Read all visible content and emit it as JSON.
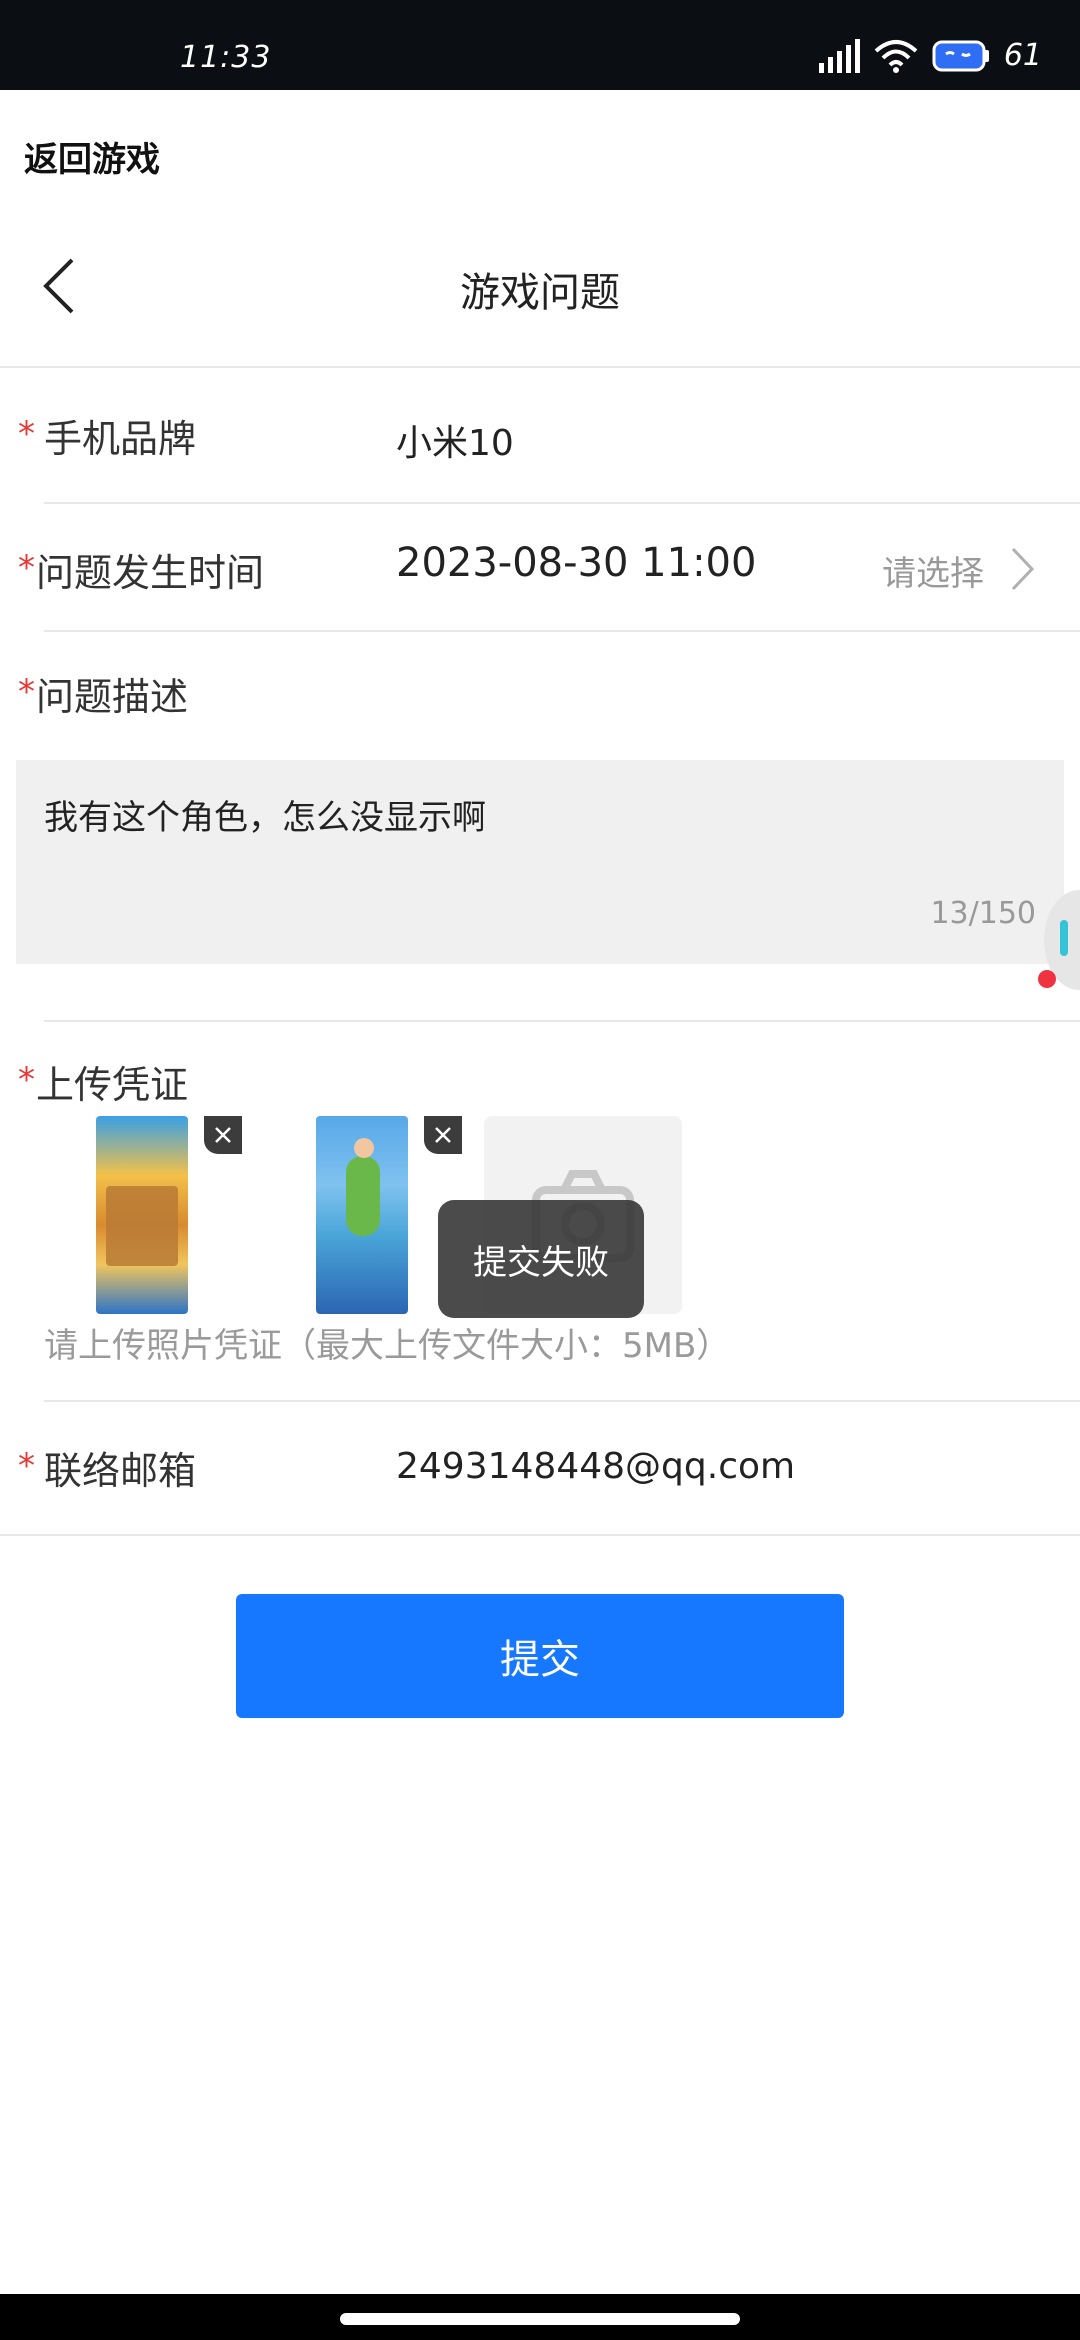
{
  "status_bar": {
    "time": "11:33",
    "battery": "61"
  },
  "return_game": "返回游戏",
  "header": {
    "title": "游戏问题"
  },
  "form": {
    "required_mark": "*",
    "phone_brand": {
      "label": "手机品牌",
      "value": "小米10"
    },
    "issue_time": {
      "label": "问题发生时间",
      "value": "2023-08-30 11:00",
      "hint": "请选择"
    },
    "description": {
      "label": "问题描述",
      "text": "我有这个角色，怎么没显示啊",
      "counter": "13/150"
    },
    "upload": {
      "label": "上传凭证",
      "hint": "请上传照片凭证（最大上传文件大小：5MB）"
    },
    "email": {
      "label": "联络邮箱",
      "value": "2493148448@qq.com"
    }
  },
  "toast": "提交失败",
  "submit_label": "提交",
  "colors": {
    "primary": "#1677ff",
    "required": "#e53935",
    "status_bar": "#0b0f14"
  }
}
